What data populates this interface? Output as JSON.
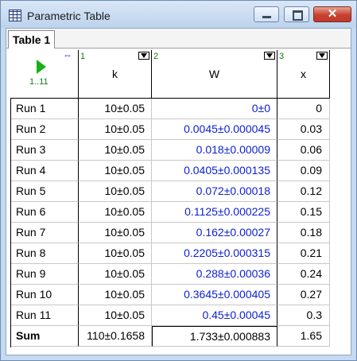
{
  "window": {
    "title": "Parametric Table",
    "close_glyph": "✕"
  },
  "tabs": [
    {
      "label": "Table 1"
    }
  ],
  "corner": {
    "range": "1..11",
    "arrows": "⇔"
  },
  "columns": [
    {
      "num": "1",
      "name": "k"
    },
    {
      "num": "2",
      "name": "W"
    },
    {
      "num": "3",
      "name": "x"
    }
  ],
  "rows": [
    {
      "run": "Run 1",
      "k": "10±0.05",
      "w": "0±0",
      "x": "0"
    },
    {
      "run": "Run 2",
      "k": "10±0.05",
      "w": "0.0045±0.000045",
      "x": "0.03"
    },
    {
      "run": "Run 3",
      "k": "10±0.05",
      "w": "0.018±0.00009",
      "x": "0.06"
    },
    {
      "run": "Run 4",
      "k": "10±0.05",
      "w": "0.0405±0.000135",
      "x": "0.09"
    },
    {
      "run": "Run 5",
      "k": "10±0.05",
      "w": "0.072±0.00018",
      "x": "0.12"
    },
    {
      "run": "Run 6",
      "k": "10±0.05",
      "w": "0.1125±0.000225",
      "x": "0.15"
    },
    {
      "run": "Run 7",
      "k": "10±0.05",
      "w": "0.162±0.00027",
      "x": "0.18"
    },
    {
      "run": "Run 8",
      "k": "10±0.05",
      "w": "0.2205±0.000315",
      "x": "0.21"
    },
    {
      "run": "Run 9",
      "k": "10±0.05",
      "w": "0.288±0.00036",
      "x": "0.24"
    },
    {
      "run": "Run 10",
      "k": "10±0.05",
      "w": "0.3645±0.000405",
      "x": "0.27"
    },
    {
      "run": "Run 11",
      "k": "10±0.05",
      "w": "0.45±0.00045",
      "x": "0.3"
    }
  ],
  "sum": {
    "run": "Sum",
    "k": "110±0.1658",
    "w": "1.733±0.000883",
    "x": "1.65"
  },
  "colors": {
    "computed_value": "#0b1fd0",
    "column_number": "#1a7a1a",
    "run_arrow": "#18b018"
  }
}
